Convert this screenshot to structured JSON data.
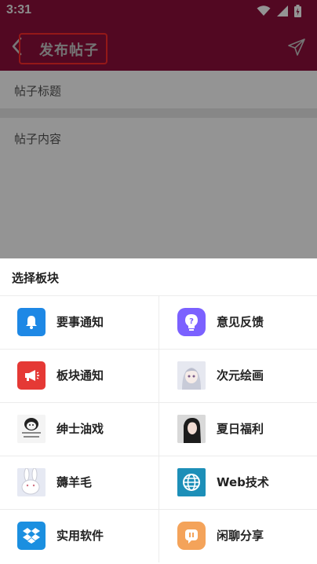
{
  "status_bar": {
    "time": "3:31"
  },
  "app_bar": {
    "title": "发布帖子"
  },
  "form": {
    "title_placeholder": "帖子标题",
    "content_placeholder": "帖子内容"
  },
  "sheet": {
    "title": "选择板块",
    "boards": [
      {
        "label": "要事通知",
        "icon": "bell-icon",
        "color": "#1e88e5"
      },
      {
        "label": "意见反馈",
        "icon": "lightbulb-icon",
        "color": "#7b61ff"
      },
      {
        "label": "板块通知",
        "icon": "megaphone-icon",
        "color": "#e53935"
      },
      {
        "label": "次元绘画",
        "icon": "anime-girl-image",
        "color": "#d7d9e3"
      },
      {
        "label": "绅士油戏",
        "icon": "meme-image",
        "color": "#f1f1f1"
      },
      {
        "label": "夏日福利",
        "icon": "girl-photo-image",
        "color": "#3a3a3a"
      },
      {
        "label": "薅羊毛",
        "icon": "rabbit-image",
        "color": "#dfe4f0"
      },
      {
        "label": "Web技术",
        "icon": "globe-icon",
        "color": "#1d8fb8"
      },
      {
        "label": "实用软件",
        "icon": "dropbox-icon",
        "color": "#1b8fe0"
      },
      {
        "label": "闲聊分享",
        "icon": "chat-icon",
        "color": "#f4a35a"
      }
    ]
  }
}
